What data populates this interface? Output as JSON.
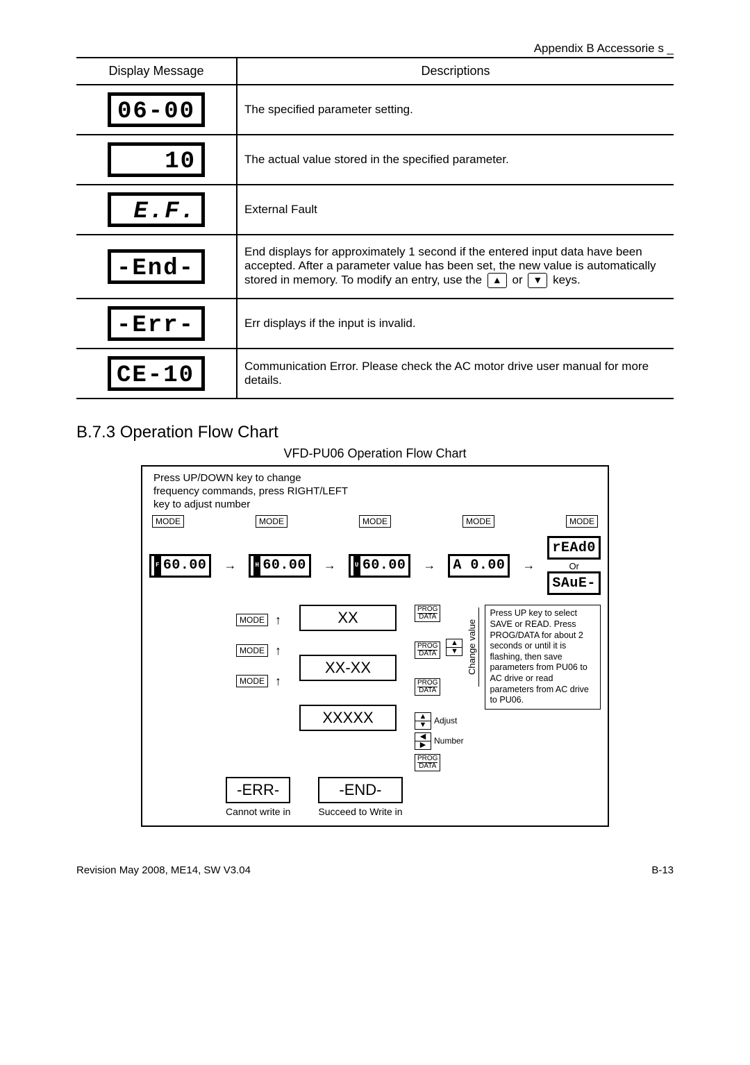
{
  "header": {
    "appendix": "Appendix B Accessorie   s _"
  },
  "table": {
    "col1": "Display Message",
    "col2": "Descriptions",
    "rows": [
      {
        "lcd": "06-00",
        "align": "lcd-c",
        "desc": "The specified parameter setting."
      },
      {
        "lcd": "10",
        "align": "right-align",
        "desc": "The actual value stored in the specified parameter."
      },
      {
        "lcd": "E.F.",
        "align": "right-align",
        "desc": "External Fault"
      },
      {
        "lcd": "-End-",
        "align": "left-align",
        "desc_pre": "End  displays for approximately 1 second if the entered input data have been accepted. After a parameter value has been set, the new value is automatically stored in memory. To modify an entry, use the ",
        "desc_mid": " or ",
        "desc_post": " keys."
      },
      {
        "lcd": "-Err-",
        "align": "left-align",
        "desc": "Err  displays if the input is invalid."
      },
      {
        "lcd": "CE-10",
        "align": "left-align",
        "desc": "Communication Error. Please check the AC motor drive user manual for more details."
      }
    ]
  },
  "section": "B.7.3 Operation Flow Chart",
  "flow": {
    "title": "VFD-PU06 Operation Flow Chart",
    "note1": "Press UP/DOWN key to change frequency commands, press RIGHT/LEFT key to adjust number",
    "mode": "MODE",
    "prog_upper": "PROG",
    "prog_lower": "DATA",
    "lcds": {
      "f": "60.00",
      "h": "60.00",
      "u": "60.00",
      "a": "A  0.00",
      "read": "rEAd0",
      "save": "SAuE-"
    },
    "or": "Or",
    "cells": {
      "a": "XX",
      "b": "XX-XX",
      "c": "XXXXX"
    },
    "vert": "Change value",
    "adjust": "Adjust",
    "number": "Number",
    "note2": "Press UP key to select SAVE or READ. Press PROG/DATA for about 2 seconds or until it is flashing, then save parameters from PU06 to AC drive or read parameters from AC drive to PU06.",
    "err": "-ERR-",
    "end": "-END-",
    "err_cap": "Cannot write in",
    "end_cap": "Succeed to Write in"
  },
  "footer": {
    "left": "Revision May 2008, ME14, SW V3.04",
    "right": "B-13"
  }
}
